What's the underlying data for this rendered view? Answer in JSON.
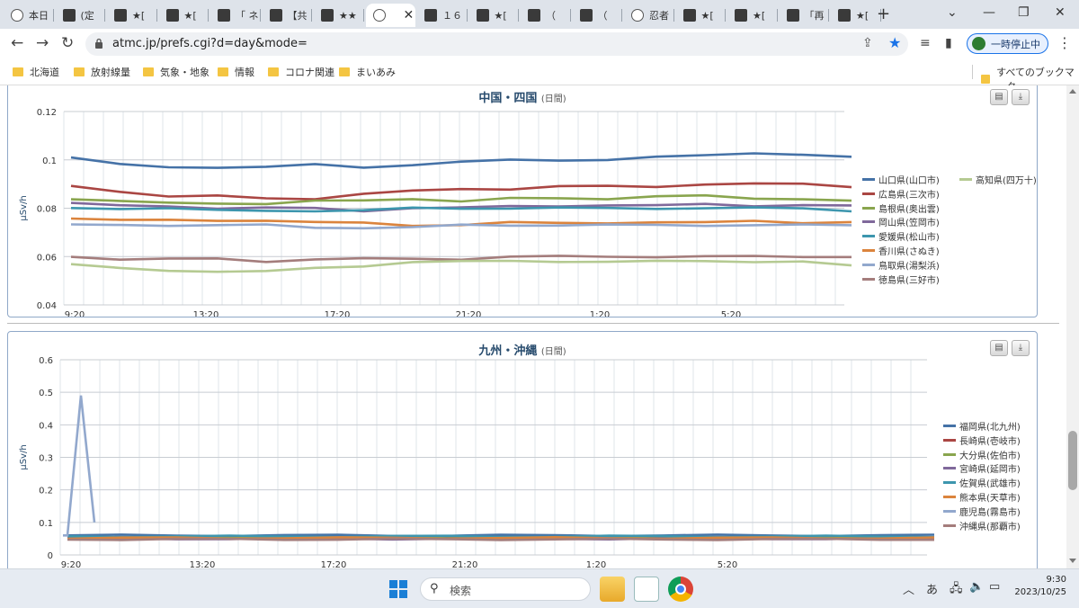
{
  "browser": {
    "tabs": [
      {
        "title": "本日",
        "favicon": "globe"
      },
      {
        "title": "(定",
        "favicon": "site"
      },
      {
        "title": "★[",
        "favicon": "site"
      },
      {
        "title": "★[",
        "favicon": "site"
      },
      {
        "title": "「 ネ",
        "favicon": "site"
      },
      {
        "title": "【共",
        "favicon": "site"
      },
      {
        "title": "★★",
        "favicon": "site"
      },
      {
        "title": "",
        "favicon": "globe",
        "active": true
      },
      {
        "title": "１６",
        "favicon": "site"
      },
      {
        "title": "★[",
        "favicon": "site"
      },
      {
        "title": "（",
        "favicon": "site"
      },
      {
        "title": "（",
        "favicon": "site"
      },
      {
        "title": "忍者",
        "favicon": "globe"
      },
      {
        "title": "★[",
        "favicon": "site"
      },
      {
        "title": "★[",
        "favicon": "site"
      },
      {
        "title": "「再",
        "favicon": "site"
      },
      {
        "title": "★[",
        "favicon": "site"
      }
    ],
    "url": "atmc.jp/prefs.cgi?d=day&mode=",
    "pause_label": "一時停止中",
    "bookmarks": [
      "北海道",
      "放射線量",
      "気象・地象",
      "情報",
      "コロナ関連",
      "まいあみ"
    ],
    "all_bookmarks": "すべてのブックマーク"
  },
  "panel1": {
    "title": "中国・四国",
    "period": "(日間)",
    "ylabel": "µSv/h"
  },
  "panel2": {
    "title": "九州・沖縄",
    "period": "(日間)",
    "ylabel": "µSv/h"
  },
  "chart_data": [
    {
      "type": "line",
      "title": "中国・四国 (日間)",
      "ylabel": "µSv/h",
      "ylim": [
        0.04,
        0.12
      ],
      "yticks": [
        "0.12",
        "0.1",
        "0.08",
        "0.06",
        "0.04"
      ],
      "xticks": [
        "9:20",
        "13:20",
        "17:20",
        "21:20",
        "1:20",
        "5:20"
      ],
      "grid": true,
      "legend": "right",
      "series": [
        {
          "name": "山口県(山口市)",
          "color": "#4572a7",
          "values": [
            0.101,
            0.098,
            0.097,
            0.097,
            0.097,
            0.098,
            0.097,
            0.098,
            0.099,
            0.1,
            0.1,
            0.1,
            0.101,
            0.102,
            0.103,
            0.102,
            0.101
          ]
        },
        {
          "name": "広島県(三次市)",
          "color": "#aa4643",
          "values": [
            0.089,
            0.087,
            0.085,
            0.085,
            0.084,
            0.084,
            0.086,
            0.087,
            0.088,
            0.088,
            0.089,
            0.089,
            0.089,
            0.09,
            0.09,
            0.09,
            0.089
          ]
        },
        {
          "name": "島根県(奥出雲)",
          "color": "#89a54e",
          "values": [
            0.084,
            0.083,
            0.082,
            0.082,
            0.082,
            0.083,
            0.083,
            0.084,
            0.083,
            0.084,
            0.084,
            0.084,
            0.085,
            0.085,
            0.084,
            0.084,
            0.083
          ]
        },
        {
          "name": "岡山県(笠岡市)",
          "color": "#80699b",
          "values": [
            0.082,
            0.081,
            0.081,
            0.08,
            0.08,
            0.08,
            0.079,
            0.08,
            0.08,
            0.081,
            0.081,
            0.081,
            0.081,
            0.082,
            0.081,
            0.081,
            0.081
          ]
        },
        {
          "name": "愛媛県(松山市)",
          "color": "#3d96ae",
          "values": [
            0.08,
            0.08,
            0.08,
            0.079,
            0.079,
            0.079,
            0.079,
            0.08,
            0.08,
            0.08,
            0.08,
            0.08,
            0.08,
            0.08,
            0.08,
            0.08,
            0.079
          ]
        },
        {
          "name": "香川県(さぬき)",
          "color": "#db843d",
          "values": [
            0.076,
            0.075,
            0.075,
            0.075,
            0.075,
            0.074,
            0.074,
            0.073,
            0.073,
            0.074,
            0.074,
            0.074,
            0.074,
            0.074,
            0.075,
            0.074,
            0.074
          ]
        },
        {
          "name": "鳥取県(湯梨浜)",
          "color": "#92a8cd",
          "values": [
            0.073,
            0.073,
            0.073,
            0.073,
            0.073,
            0.072,
            0.072,
            0.072,
            0.073,
            0.073,
            0.073,
            0.073,
            0.073,
            0.073,
            0.073,
            0.073,
            0.073
          ]
        },
        {
          "name": "徳島県(三好市)",
          "color": "#a47d7c",
          "values": [
            0.06,
            0.059,
            0.059,
            0.059,
            0.058,
            0.059,
            0.059,
            0.059,
            0.059,
            0.06,
            0.06,
            0.06,
            0.06,
            0.06,
            0.06,
            0.06,
            0.06
          ]
        },
        {
          "name": "高知県(四万十)",
          "color": "#b5ca92",
          "values": [
            0.057,
            0.055,
            0.054,
            0.054,
            0.054,
            0.055,
            0.056,
            0.058,
            0.058,
            0.058,
            0.058,
            0.058,
            0.058,
            0.058,
            0.058,
            0.058,
            0.056
          ]
        }
      ]
    },
    {
      "type": "line",
      "title": "九州・沖縄 (日間)",
      "ylabel": "µSv/h",
      "ylim": [
        0,
        0.6
      ],
      "yticks": [
        "0.6",
        "0.5",
        "0.4",
        "0.3",
        "0.2",
        "0.1",
        "0"
      ],
      "xticks": [
        "9:20",
        "13:20",
        "17:20",
        "21:20",
        "1:20",
        "5:20"
      ],
      "grid": true,
      "legend": "right",
      "series": [
        {
          "name": "福岡県(北九州)",
          "color": "#4572a7",
          "values": [
            0.06,
            0.06,
            0.06,
            0.06,
            0.06,
            0.06,
            0.06,
            0.06,
            0.06,
            0.06,
            0.06,
            0.06,
            0.06,
            0.06,
            0.06,
            0.06,
            0.06
          ]
        },
        {
          "name": "長崎県(壱岐市)",
          "color": "#aa4643",
          "values": [
            0.055,
            0.055,
            0.055,
            0.055,
            0.055,
            0.055,
            0.055,
            0.055,
            0.055,
            0.055,
            0.055,
            0.055,
            0.055,
            0.055,
            0.055,
            0.055,
            0.055
          ]
        },
        {
          "name": "大分県(佐伯市)",
          "color": "#89a54e",
          "values": [
            0.053,
            0.053,
            0.053,
            0.053,
            0.053,
            0.053,
            0.053,
            0.053,
            0.053,
            0.053,
            0.053,
            0.053,
            0.053,
            0.053,
            0.053,
            0.053,
            0.053
          ]
        },
        {
          "name": "宮崎県(延岡市)",
          "color": "#80699b",
          "values": [
            0.05,
            0.05,
            0.05,
            0.05,
            0.05,
            0.05,
            0.05,
            0.05,
            0.05,
            0.05,
            0.05,
            0.05,
            0.05,
            0.05,
            0.05,
            0.05,
            0.05
          ]
        },
        {
          "name": "佐賀県(武雄市)",
          "color": "#3d96ae",
          "values": [
            0.057,
            0.057,
            0.057,
            0.057,
            0.057,
            0.057,
            0.057,
            0.057,
            0.057,
            0.057,
            0.057,
            0.057,
            0.057,
            0.057,
            0.057,
            0.057,
            0.057
          ]
        },
        {
          "name": "熊本県(天草市)",
          "color": "#db843d",
          "values": [
            0.052,
            0.052,
            0.052,
            0.052,
            0.052,
            0.052,
            0.052,
            0.052,
            0.052,
            0.052,
            0.052,
            0.052,
            0.052,
            0.052,
            0.052,
            0.052,
            0.052
          ]
        },
        {
          "name": "鹿児島(霧島市)",
          "color": "#92a8cd",
          "values": [
            0.06,
            0.49,
            0.1
          ]
        },
        {
          "name": "沖縄県(那覇市)",
          "color": "#a47d7c",
          "values": [
            0.048,
            0.048,
            0.048,
            0.048,
            0.048,
            0.048,
            0.048,
            0.048,
            0.048,
            0.048,
            0.048,
            0.048,
            0.048,
            0.048,
            0.048,
            0.048,
            0.048
          ]
        }
      ]
    }
  ],
  "taskbar": {
    "search_label": "検索",
    "ime": "あ",
    "time": "9:30",
    "date": "2023/10/25"
  }
}
